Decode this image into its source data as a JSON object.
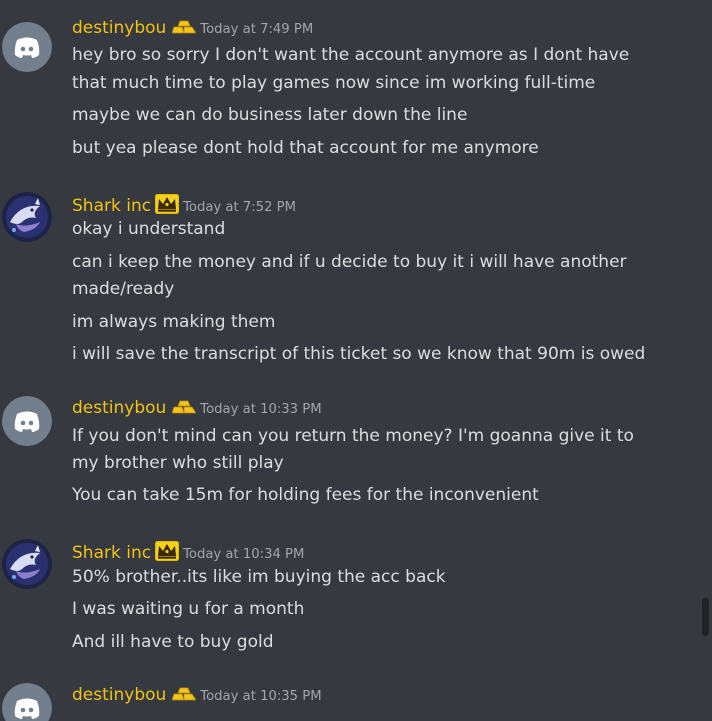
{
  "colors": {
    "background": "#36393f",
    "username": "#f1c40f",
    "text": "#dcddde",
    "timestamp": "#a3a6aa",
    "discord_blurple": "#5865f2",
    "default_avatar_gray": "#747f8d"
  },
  "messages": [
    {
      "author": "destinybou",
      "avatar": "discord-default-avatar",
      "role_icon": "gold-bars-icon",
      "timestamp": "Today at 7:49 PM",
      "lines": [
        "hey bro so sorry I don't want the account anymore as I dont have",
        "that much time to play games now since im working full-time",
        "maybe we can do business later down the line",
        "but yea please dont hold that account for me anymore"
      ]
    },
    {
      "author": "Shark inc",
      "avatar": "shark-avatar",
      "role_icon": "crown-icon",
      "timestamp": "Today at 7:52 PM",
      "lines": [
        "okay i understand",
        "can i keep the money and if u decide to buy it i will have another",
        "made/ready",
        "im always making them",
        "i will save the transcript of this ticket so we know that 90m is owed"
      ]
    },
    {
      "author": "destinybou",
      "avatar": "discord-default-avatar",
      "role_icon": "gold-bars-icon",
      "timestamp": "Today at 10:33 PM",
      "lines": [
        "If you don't mind can you return the money? I'm goanna give it  to",
        "my brother who still play",
        "You can take 15m for holding fees for the inconvenient"
      ]
    },
    {
      "author": "Shark inc",
      "avatar": "shark-avatar",
      "role_icon": "crown-icon",
      "timestamp": "Today at 10:34 PM",
      "lines": [
        "50% brother..its like im buying the acc back",
        "I was waiting u for a month",
        "And ill have to buy gold"
      ]
    },
    {
      "author": "destinybou",
      "avatar": "discord-default-avatar",
      "role_icon": "gold-bars-icon",
      "timestamp": "Today at 10:35 PM",
      "lines": []
    }
  ]
}
